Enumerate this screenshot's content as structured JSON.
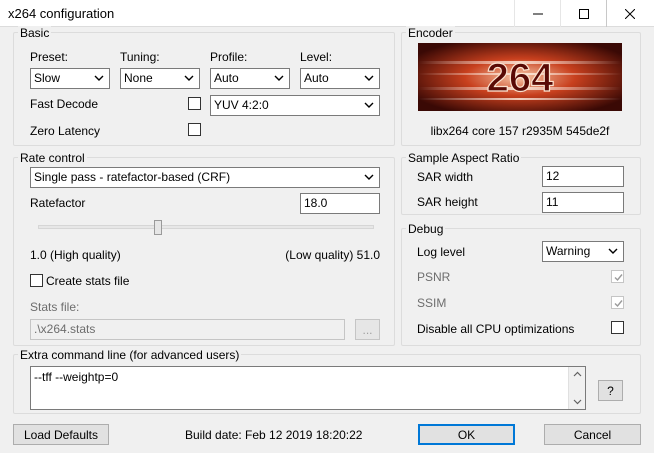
{
  "window": {
    "title": "x264 configuration"
  },
  "basic": {
    "title": "Basic",
    "preset_label": "Preset:",
    "preset_value": "Slow",
    "tuning_label": "Tuning:",
    "tuning_value": "None",
    "profile_label": "Profile:",
    "profile_value": "Auto",
    "level_label": "Level:",
    "level_value": "Auto",
    "colorspace_value": "YUV 4:2:0",
    "fast_decode_label": "Fast Decode",
    "fast_decode_checked": false,
    "zero_latency_label": "Zero Latency",
    "zero_latency_checked": false
  },
  "encoder": {
    "title": "Encoder",
    "logo_text": "264",
    "version": "libx264 core 157 r2935M 545de2f"
  },
  "rate_control": {
    "title": "Rate control",
    "mode_value": "Single pass - ratefactor-based (CRF)",
    "ratefactor_label": "Ratefactor",
    "ratefactor_value": "18.0",
    "slider_fraction": 0.353,
    "min_label": "1.0 (High quality)",
    "max_label": "(Low quality) 51.0",
    "create_stats_label": "Create stats file",
    "create_stats_checked": false,
    "stats_file_label": "Stats file:",
    "stats_file_value": ".\\x264.stats",
    "browse_label": "..."
  },
  "sar": {
    "title": "Sample Aspect Ratio",
    "width_label": "SAR width",
    "width_value": "12",
    "height_label": "SAR height",
    "height_value": "11"
  },
  "debug": {
    "title": "Debug",
    "log_level_label": "Log level",
    "log_level_value": "Warning",
    "psnr_label": "PSNR",
    "psnr_checked": true,
    "ssim_label": "SSIM",
    "ssim_checked": true,
    "disable_cpu_label": "Disable all CPU optimizations",
    "disable_cpu_checked": false
  },
  "extra": {
    "title": "Extra command line (for advanced users)",
    "value": "--tff --weightp=0",
    "help_label": "?"
  },
  "footer": {
    "load_defaults_label": "Load Defaults",
    "build_date": "Build date: Feb 12 2019 18:20:22",
    "ok_label": "OK",
    "cancel_label": "Cancel"
  }
}
